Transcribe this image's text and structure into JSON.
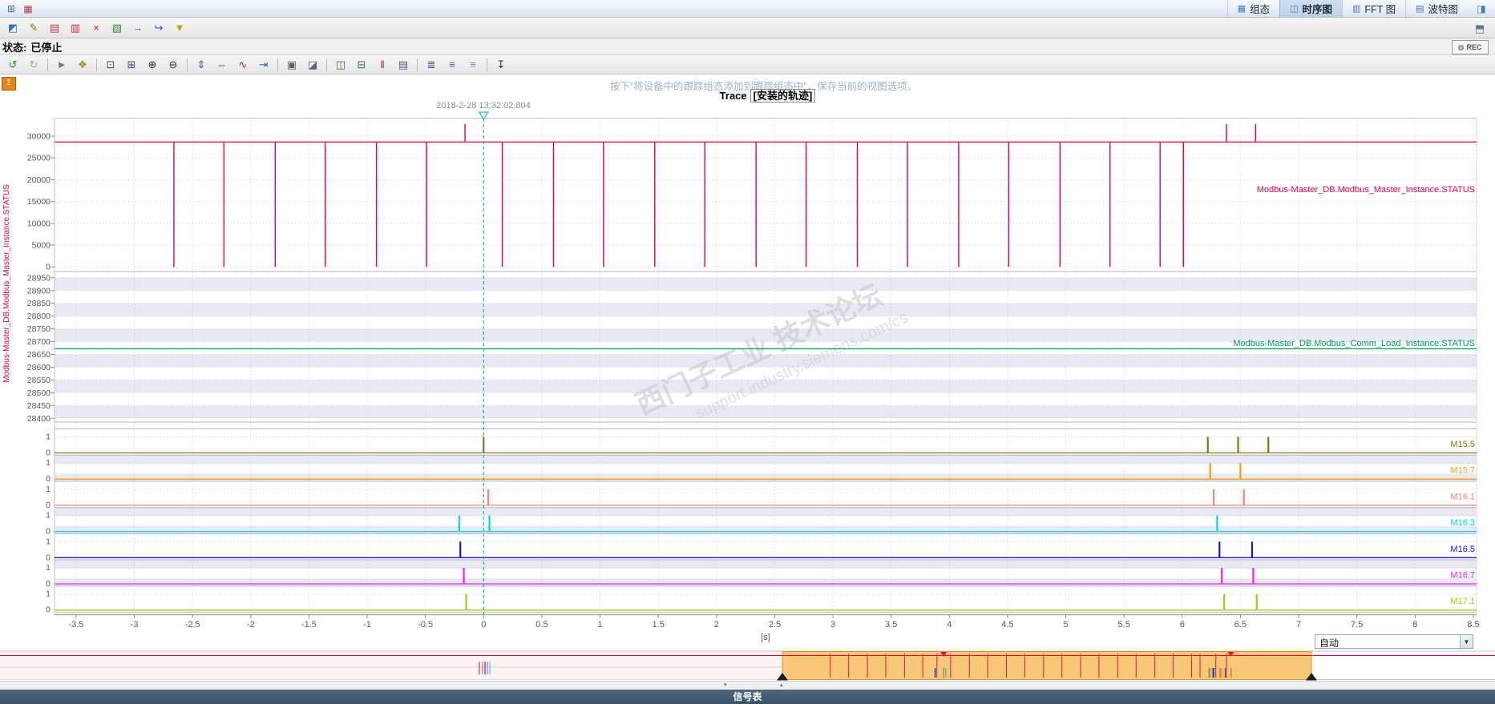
{
  "window": {
    "tabs": [
      {
        "name": "tab-configuration",
        "label": "组态",
        "glyph": "▦",
        "selected": false
      },
      {
        "name": "tab-timing-diagram",
        "label": "时序图",
        "glyph": "◫",
        "selected": true
      },
      {
        "name": "tab-fft-diagram",
        "label": "FFT 图",
        "glyph": "▥",
        "selected": false
      },
      {
        "name": "tab-bode-diagram",
        "label": "波特图",
        "glyph": "▤",
        "selected": false
      }
    ],
    "corner_left_icons": [
      {
        "name": "trace-tasks-icon",
        "glyph": "⊞",
        "color": "#3a6fb5"
      },
      {
        "name": "measurement-list-icon",
        "glyph": "▦",
        "color": "#b04040"
      }
    ],
    "corner_right_icon": {
      "name": "window-dock-icon",
      "glyph": "◨",
      "color": "#4a7ab5"
    }
  },
  "toolbar_main": {
    "icons": [
      {
        "name": "trace-compare-icon",
        "glyph": "◩",
        "color": "#3a6fb5"
      },
      {
        "name": "edit-signals-icon",
        "glyph": "✎",
        "color": "#a06820"
      },
      {
        "name": "trace-chart-icon",
        "glyph": "▤",
        "color": "#c03048"
      },
      {
        "name": "trace-chart-add-icon",
        "glyph": "▥",
        "color": "#c03048"
      },
      {
        "name": "delete-trace-icon",
        "glyph": "×",
        "color": "#cc2020"
      },
      {
        "name": "add-measurement-icon",
        "glyph": "▧",
        "color": "#3a8a3a"
      },
      {
        "name": "export-measurement-icon",
        "glyph": "→",
        "color": "#2a5fae"
      },
      {
        "name": "import-measurement-icon",
        "glyph": "↪",
        "color": "#2a5fae"
      },
      {
        "name": "filter-icon",
        "glyph": "▼",
        "color": "#c8a400"
      }
    ],
    "right_icon": {
      "name": "detach-view-icon",
      "glyph": "⬒",
      "color": "#5a7a9a"
    }
  },
  "status": {
    "label": "状态:",
    "value": "已停止",
    "rec": "REC"
  },
  "toolbar_chart": {
    "icons": [
      {
        "name": "back-view-icon",
        "glyph": "↺",
        "color": "#189818"
      },
      {
        "name": "forward-view-icon",
        "glyph": "↻",
        "color": "#8fbb8f"
      },
      {
        "sep": true
      },
      {
        "name": "select-mode-icon",
        "glyph": "►",
        "color": "#787878"
      },
      {
        "name": "pan-mode-icon",
        "glyph": "❖",
        "color": "#a5851d"
      },
      {
        "sep": true
      },
      {
        "name": "zoom-region-icon",
        "glyph": "⊡",
        "color": "#44449a"
      },
      {
        "name": "zoom-time-region-icon",
        "glyph": "⊞",
        "color": "#44449a"
      },
      {
        "name": "zoom-in-icon",
        "glyph": "⊕",
        "color": "#333333"
      },
      {
        "name": "zoom-out-icon",
        "glyph": "⊖",
        "color": "#333333"
      },
      {
        "sep": true
      },
      {
        "name": "scale-y-100-icon",
        "glyph": "⇕",
        "color": "#2a5fae"
      },
      {
        "name": "scale-x-100-icon",
        "glyph": "⇔",
        "color": "#2a5fae"
      },
      {
        "name": "autoscale-icon",
        "glyph": "∿",
        "color": "#a03030"
      },
      {
        "name": "align-trigger-icon",
        "glyph": "⇥",
        "color": "#2a5fae"
      },
      {
        "sep": true
      },
      {
        "name": "snapshot-icon",
        "glyph": "▣",
        "color": "#556677"
      },
      {
        "name": "compare-snapshot-icon",
        "glyph": "◪",
        "color": "#556677"
      },
      {
        "sep": true
      },
      {
        "name": "measure-vertical-icon",
        "glyph": "◫",
        "color": "#3a7a3a"
      },
      {
        "name": "measure-horizontal-icon",
        "glyph": "⊟",
        "color": "#3a7a3a"
      },
      {
        "name": "cursor-measure-icon",
        "glyph": "‖",
        "color": "#c02020"
      },
      {
        "name": "overview-toggle-icon",
        "glyph": "▤",
        "color": "#556677"
      },
      {
        "sep": true
      },
      {
        "name": "legend-numbered-icon",
        "glyph": "≣",
        "color": "#2a5fae"
      },
      {
        "name": "legend-left-icon",
        "glyph": "≡",
        "color": "#2a5fae"
      },
      {
        "name": "legend-right-icon",
        "glyph": "≡",
        "color": "#6a8fc0"
      },
      {
        "sep": true
      },
      {
        "name": "save-view-icon",
        "glyph": "↧",
        "color": "#333333"
      }
    ]
  },
  "hint": "按下“将设备中的跟踪组态添加到跟踪组态中”，保存当前的视图选项。",
  "title": {
    "prefix": "Trace",
    "boxed": "[安装的轨迹]"
  },
  "watermark": {
    "line1": "西门子工业  技术论坛",
    "line2": "support.industry.siemens.com/cs"
  },
  "overview": {
    "auto": "自动"
  },
  "bottom": {
    "signal_table": "信号表"
  },
  "chart_data": {
    "type": "line",
    "x_unit": "[s]",
    "x_range": [
      -3.5,
      8.5
    ],
    "x_tick_step": 0.5,
    "cursor": {
      "time": 0,
      "label": "2018-2-28 13:32:02.804",
      "color": "#00a8b4"
    },
    "left_axis_label": "Modbus-Master_DB.Modbus_Master_Instance.STATUS",
    "rows": [
      {
        "name": "Modbus-Master_DB.Modbus_Master_Instance.STATUS",
        "kind": "analog",
        "color": "#e50041",
        "striped": false,
        "y_ticks": [
          30000,
          25000,
          20000,
          15000,
          10000,
          5000,
          0
        ],
        "baseline": 28672,
        "dips": {
          "value": 0,
          "times": [
            -2.66,
            -2.23,
            -1.79,
            -1.36,
            -0.92,
            -0.49,
            0.16,
            0.6,
            1.03,
            1.47,
            1.9,
            2.34,
            2.77,
            3.21,
            3.64,
            4.08,
            4.51,
            4.95,
            5.38,
            5.81,
            6.01
          ]
        },
        "spikes": {
          "value": 32767,
          "times": [
            -0.16,
            6.38,
            6.63
          ]
        }
      },
      {
        "name": "Modbus-Master_DB.Modbus_Comm_Load_Instance.STATUS",
        "kind": "analog",
        "color": "#00a05a",
        "striped": true,
        "y_ticks": [
          28950,
          28900,
          28850,
          28800,
          28750,
          28700,
          28650,
          28600,
          28550,
          28500,
          28450,
          28400
        ],
        "baseline": 28672,
        "dips": {
          "value": 28672,
          "times": []
        },
        "spikes": {
          "value": 28672,
          "times": []
        }
      },
      {
        "name": "M15.5",
        "kind": "bool",
        "color": "#857508",
        "striped": false,
        "y_ticks": [
          1,
          0
        ],
        "pulses": [
          0,
          6.22,
          6.48,
          6.74
        ]
      },
      {
        "name": "M15.7",
        "kind": "bool",
        "color": "#f0a020",
        "striped": true,
        "y_ticks": [
          1,
          0
        ],
        "pulses": [
          6.24,
          6.5
        ]
      },
      {
        "name": "M16.1",
        "kind": "bool",
        "color": "#f08878",
        "striped": false,
        "y_ticks": [
          1,
          0
        ],
        "pulses": [
          0.04,
          6.27,
          6.53
        ]
      },
      {
        "name": "M16.3",
        "kind": "bool",
        "color": "#00d8e8",
        "striped": true,
        "y_ticks": [
          1,
          0
        ],
        "pulses": [
          -0.21,
          0.05,
          6.3
        ]
      },
      {
        "name": "M16.5",
        "kind": "bool",
        "color": "#1616d0",
        "striped": false,
        "y_ticks": [
          1,
          0
        ],
        "pulses": [
          -0.2,
          6.32,
          6.6
        ]
      },
      {
        "name": "M16.7",
        "kind": "bool",
        "color": "#f020f0",
        "striped": true,
        "y_ticks": [
          1,
          0
        ],
        "pulses": [
          -0.17,
          6.34,
          6.61
        ]
      },
      {
        "name": "M17.1",
        "kind": "bool",
        "color": "#a8c818",
        "striped": false,
        "y_ticks": [
          1,
          0
        ],
        "pulses": [
          -0.15,
          6.36,
          6.64
        ]
      }
    ]
  }
}
